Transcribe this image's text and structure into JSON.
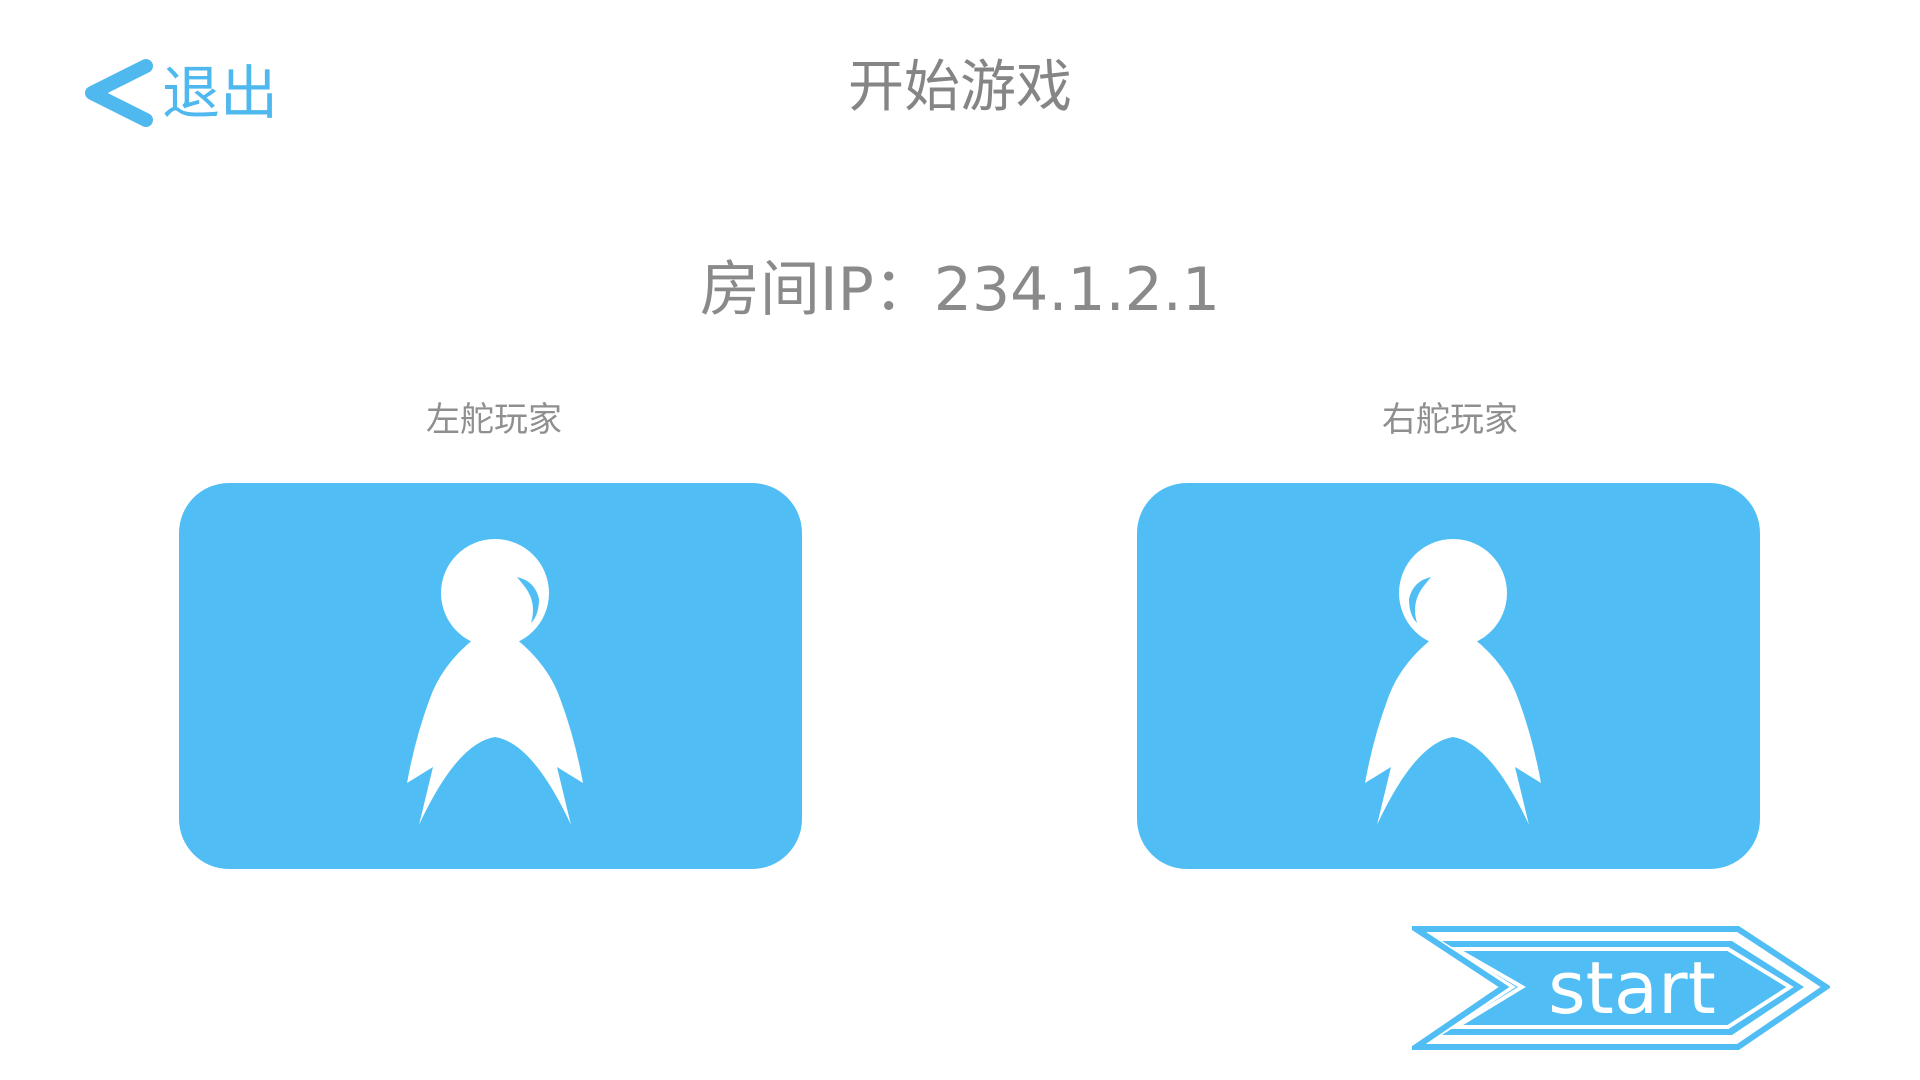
{
  "header": {
    "back_label": "退出",
    "back_icon": "chevron-left-icon",
    "title": "开始游戏"
  },
  "room": {
    "ip_text": "房间IP：234.1.2.1"
  },
  "players": {
    "left": {
      "label": "左舵玩家",
      "icon": "player-avatar-icon"
    },
    "right": {
      "label": "右舵玩家",
      "icon": "player-avatar-icon"
    }
  },
  "start": {
    "label": "start"
  },
  "colors": {
    "accent": "#50bef5",
    "text_gray": "#8a8a8a",
    "background": "#ffffff"
  }
}
